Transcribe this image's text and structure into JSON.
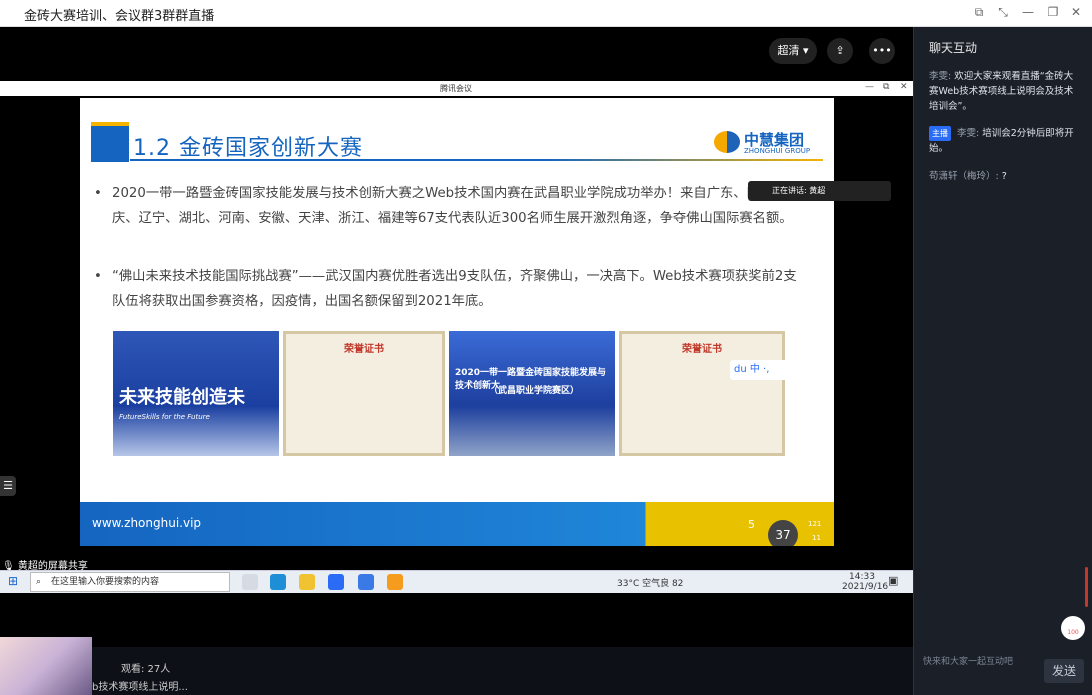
{
  "window": {
    "title": "金砖大赛培训、会议群3群群直播"
  },
  "player": {
    "quality": "超清",
    "more": "•••"
  },
  "meeting": {
    "title": "腾讯会议",
    "speaking": "正在讲话: 黄超",
    "share_label": "黄超的屏幕共享",
    "pct": "37",
    "speed_up": "121",
    "speed_down": "11"
  },
  "slide": {
    "heading": "1.2 金砖国家创新大赛",
    "logo_name": "中慧集团",
    "logo_en": "ZHONGHUI GROUP",
    "bullet1": "2020一带一路暨金砖国家技能发展与技术创新大赛之Web技术国内赛在武昌职业学院成功举办！来自广东、四川、重庆、辽宁、湖北、河南、安徽、天津、浙江、福建等67支代表队近300名师生展开激烈角逐，争夺佛山国际赛名额。",
    "bullet2": "“佛山未来技术技能国际挑战赛”——武汉国内赛优胜者选出9支队伍，齐聚佛山，一决高下。Web技术赛项获奖前2支队伍将获取出国参赛资格，因疫情，出国名额保留到2021年底。",
    "photo1_text": "未来技能创造未",
    "photo1_sub": "FutureSkills for the Future",
    "photo3_text": "2020一带一路暨金砖国家技能发展与技术创新大",
    "photo3_sub": "（武昌职业学院赛区）",
    "cert_title": "荣誉证书",
    "url": "www.zhonghui.vip",
    "page_num": "5"
  },
  "taskbar": {
    "search_placeholder": "在这里输入你要搜索的内容",
    "weather": "33°C 空气良 82",
    "time": "14:33",
    "date": "2021/9/16"
  },
  "live": {
    "viewers": "观看: 27人",
    "title": "b技术赛项线上说明..."
  },
  "chat": {
    "title": "聊天互动",
    "messages": [
      {
        "badge": "",
        "name": "李雯:",
        "text": "欢迎大家来观看直播“金砖大赛Web技术赛项线上说明会及技术培训会”。"
      },
      {
        "badge": "主播",
        "name": "李雯:",
        "text": "培训会2分钟后即将开始。"
      },
      {
        "badge": "",
        "name": "苟潇轩（梅玲）:",
        "text": "?"
      }
    ],
    "input_placeholder": "快来和大家一起互动吧",
    "send": "发送",
    "likes": "100"
  },
  "colors": {
    "accent": "#1565c0",
    "gold": "#f5b400",
    "chat_bg": "#1b1f27"
  }
}
